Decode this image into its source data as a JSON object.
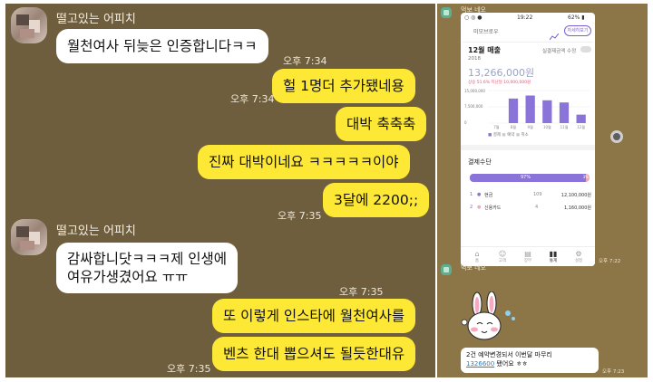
{
  "chat": {
    "group1": {
      "sender": "떨고있는 어피치",
      "messages": [
        {
          "side": "in",
          "text": "월천여사 뒤늦은  인증합니다ㅋㅋ"
        },
        {
          "side": "out",
          "text": "헐 1명더 추가됐네용",
          "time": "오후 7:34"
        },
        {
          "side": "out",
          "text": "대박 축축축",
          "time": "오후 7:34"
        },
        {
          "side": "out",
          "text": "진짜 대박이네요 ㅋㅋㅋㅋㅋ이야"
        },
        {
          "side": "out",
          "text": "3달에 2200;;",
          "time": "오후 7:35"
        }
      ]
    },
    "group2": {
      "sender": "떨고있는 어피치",
      "messages": [
        {
          "side": "in",
          "line1": "감싸합니닷ㅋㅋㅋ제 인생에",
          "line2": "여유가생겼어요 ㅠㅠ",
          "time": "오후 7:35"
        },
        {
          "side": "out",
          "text": "또 이렇게 인스타에 월천여사를"
        },
        {
          "side": "out",
          "text": "벤츠 한대 뽑으셔도 될듯한대유",
          "time": "오후 7:35"
        }
      ]
    }
  },
  "right_chat": {
    "sender_top": "먹보 네오",
    "sender_bottom": "먹보 네오",
    "screenshot_time": "오후 7:22",
    "message_line1": "2건 예약변경되서 이번달 마무리",
    "message_number": "1326600",
    "message_suffix": " 됐어요 ㅎㅎ",
    "message_time": "오후 7:23",
    "colors": {
      "bar": "#8a73d9",
      "accent": "#7b5fd6"
    }
  },
  "phone": {
    "status_left": "○ ◎ ●",
    "status_time": "19:22",
    "status_right": "62% ▮",
    "shop_name": "미모브로우",
    "header_button": "자세히보기",
    "month_title": "12월 매출",
    "year": "2018",
    "toggle_label": "실결제금액 수정",
    "revenue": "13,266,000원",
    "compare_text": "상승 51.6%  지난달 10,000,000원",
    "y_labels": [
      "15,000,000",
      "7,500,000",
      "0"
    ],
    "chart_data": {
      "type": "bar",
      "categories": [
        "7",
        "8",
        "9",
        "10",
        "11",
        "12"
      ],
      "values": [
        0,
        11300000,
        12700000,
        10500000,
        9500000,
        3900000
      ],
      "ylim": [
        0,
        15000000
      ]
    },
    "x_labels": [
      "7월",
      "8월",
      "9월",
      "10월",
      "11월",
      "12월"
    ],
    "legend": [
      "결제",
      "예약",
      "취소"
    ],
    "payment_title": "결제수단",
    "progress_left": "97%",
    "progress_right": "3%",
    "progress_fraction": 0.97,
    "methods": [
      {
        "index": "1",
        "name": "현금",
        "count": "109",
        "amount": "12,100,000원"
      },
      {
        "index": "2",
        "name": "신용카드",
        "count": "4",
        "amount": "1,160,000원"
      }
    ],
    "nav": [
      "홈",
      "고객",
      "장부",
      "통계",
      "설정"
    ]
  }
}
